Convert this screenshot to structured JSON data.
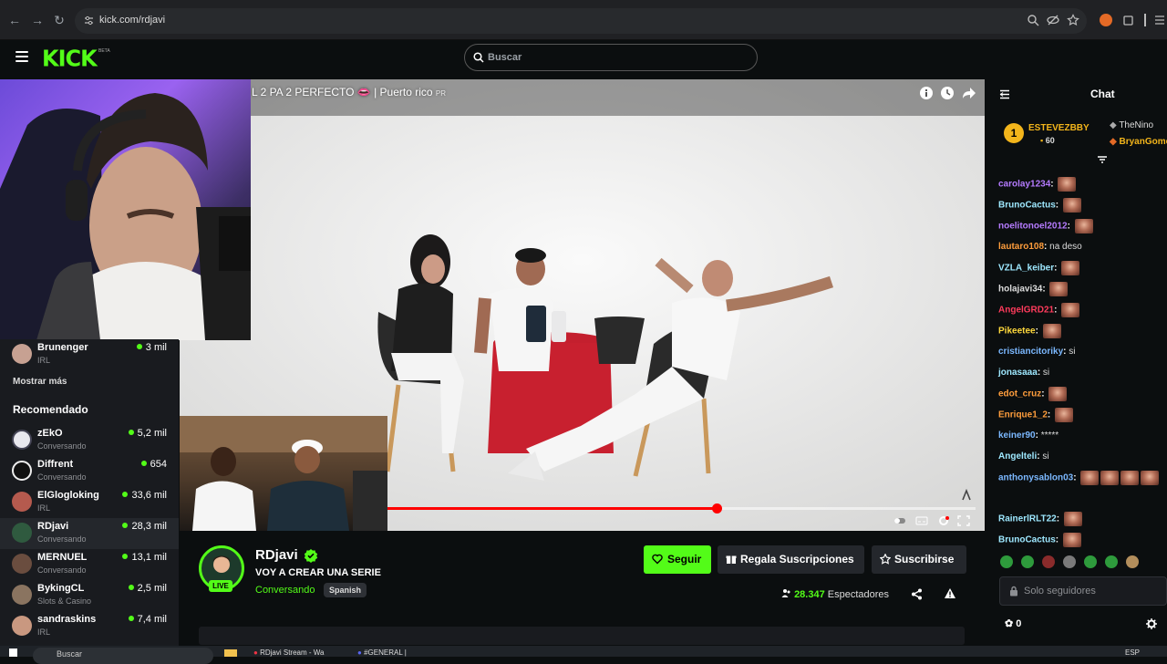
{
  "browser": {
    "url": "kick.com/rdjavi"
  },
  "header": {
    "logo_text": "KICK",
    "logo_beta": "BETA",
    "search_placeholder": "Buscar"
  },
  "video": {
    "title": "L 2 PA 2 PERFECTO 👄 | Puerto rico",
    "title_suffix": "PR",
    "progress": 0.56
  },
  "sidebar": {
    "top_item": {
      "name": "Brunenger",
      "category": "IRL",
      "viewers": "3 mil"
    },
    "show_more": "Mostrar más",
    "recommended_heading": "Recomendado",
    "items": [
      {
        "name": "zEkO",
        "category": "Conversando",
        "viewers": "5,2 mil"
      },
      {
        "name": "Diffrent",
        "category": "Conversando",
        "viewers": "654"
      },
      {
        "name": "ElGlogloking",
        "category": "IRL",
        "viewers": "33,6 mil"
      },
      {
        "name": "RDjavi",
        "category": "Conversando",
        "viewers": "28,3 mil"
      },
      {
        "name": "MERNUEL",
        "category": "Conversando",
        "viewers": "13,1 mil"
      },
      {
        "name": "BykingCL",
        "category": "Slots & Casino",
        "viewers": "2,5 mil"
      },
      {
        "name": "sandraskins",
        "category": "IRL",
        "viewers": "7,4 mil"
      }
    ]
  },
  "channel": {
    "name": "RDjavi",
    "live_label": "LIVE",
    "stream_title": "VOY A CREAR UNA SERIE",
    "category": "Conversando",
    "language": "Spanish",
    "follow_label": "Seguir",
    "gift_label": "Regala Suscripciones",
    "subscribe_label": "Suscribirse",
    "viewer_count": "28.347",
    "viewer_label": "Espectadores"
  },
  "chat": {
    "title": "Chat",
    "leaderboard": {
      "first_rank": "1",
      "first_name": "ESTEVEZBBY",
      "first_count": "60",
      "second_name": "TheNino",
      "third_name": "BryanGomez"
    },
    "messages": [
      {
        "user": "carolay1234",
        "color": "#b57bff",
        "text": "",
        "emotes": 1
      },
      {
        "user": "BrunoCactus",
        "color": "#9ee8ff",
        "text": "",
        "emotes": 1
      },
      {
        "user": "noelitonoel2012",
        "color": "#b57bff",
        "text": "",
        "emotes": 1
      },
      {
        "user": "lautaro108",
        "color": "#ff9d3c",
        "text": "na deso",
        "emotes": 0
      },
      {
        "user": "VZLA_keiber",
        "color": "#9ee8ff",
        "text": "",
        "emotes": 1
      },
      {
        "user": "holajavi34",
        "color": "#dcdcdc",
        "text": "",
        "emotes": 1
      },
      {
        "user": "AngelGRD21",
        "color": "#ff3b5c",
        "text": "",
        "emotes": 1
      },
      {
        "user": "Pikeetee",
        "color": "#ffd93c",
        "text": "",
        "emotes": 1
      },
      {
        "user": "cristiancitoriky",
        "color": "#7bb8ff",
        "text": "si",
        "emotes": 0
      },
      {
        "user": "jonasaaa",
        "color": "#9ee8ff",
        "text": "si",
        "emotes": 0
      },
      {
        "user": "edot_cruz",
        "color": "#ff9d3c",
        "text": "",
        "emotes": 1
      },
      {
        "user": "Enrique1_2",
        "color": "#ff9d3c",
        "text": "",
        "emotes": 1
      },
      {
        "user": "keiner90",
        "color": "#7bb8ff",
        "text": "*****",
        "emotes": 0
      },
      {
        "user": "Angelteli",
        "color": "#9ee8ff",
        "text": "si",
        "emotes": 0
      },
      {
        "user": "anthonysablon03",
        "color": "#7bb8ff",
        "text": "",
        "emotes": 4
      },
      {
        "user": "RainerlRLT22",
        "color": "#9ee8ff",
        "text": "",
        "emotes": 1
      },
      {
        "user": "BrunoCactus",
        "color": "#9ee8ff",
        "text": "",
        "emotes": 1
      }
    ],
    "input_placeholder": "Solo seguidores",
    "points": "0"
  },
  "taskbar": {
    "search_placeholder": "Buscar",
    "task_1": "RDjavi Stream - Wa",
    "task_2": "#GENERAL |",
    "lang": "ESP"
  }
}
